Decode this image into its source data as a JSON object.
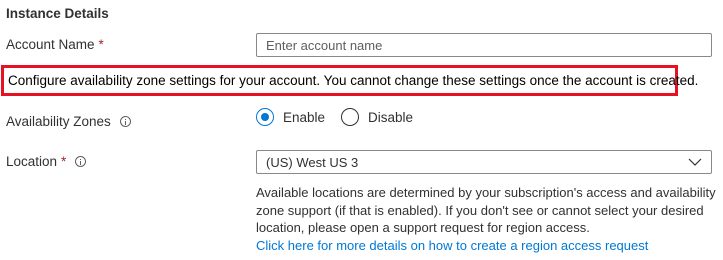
{
  "section": {
    "title": "Instance Details"
  },
  "account_name": {
    "label": "Account Name",
    "required_marker": "*",
    "placeholder": "Enter account name",
    "value": ""
  },
  "notice": {
    "text": "Configure availability zone settings for your account. You cannot change these settings once the account is created.",
    "border_color": "#e81123"
  },
  "availability_zones": {
    "label": "Availability Zones",
    "info_icon": "info-icon",
    "options": [
      {
        "label": "Enable",
        "selected": true
      },
      {
        "label": "Disable",
        "selected": false
      }
    ]
  },
  "location": {
    "label": "Location",
    "required_marker": "*",
    "info_icon": "info-icon",
    "selected_value": "(US) West US 3",
    "dropdown_icon": "chevron-down-icon",
    "help_text": "Available locations are determined by your subscription's access and availability zone support (if that is enabled). If you don't see or cannot select your desired location, please open a support request for region access.",
    "help_link": "Click here for more details on how to create a region access request"
  },
  "colors": {
    "accent": "#0078d4",
    "required": "#a4262c",
    "text": "#323130",
    "border": "#8a8886"
  }
}
